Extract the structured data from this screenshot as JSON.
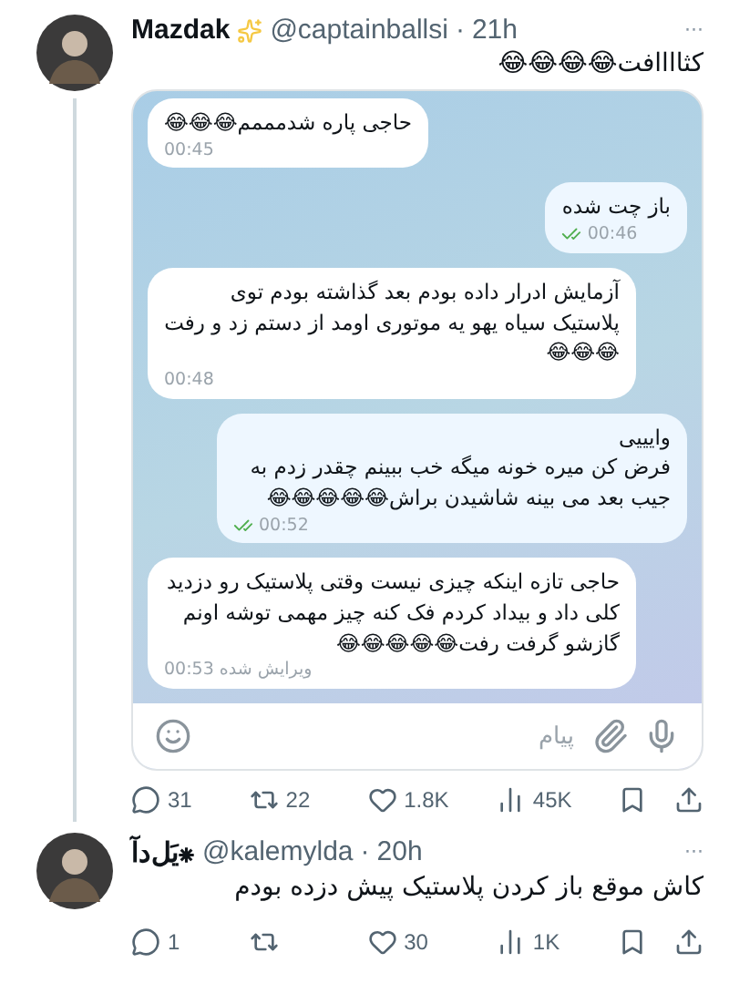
{
  "tweets": [
    {
      "author": "Mazdak",
      "verified_sparkle": true,
      "handle": "@captainballsi",
      "separator": "·",
      "time": "21h",
      "more": "···",
      "text": "کثاااافت😂😂😂😂",
      "chat": {
        "messages": [
          {
            "kind": "in",
            "text": "حاجی پاره شدمممم😂😂😂",
            "time": "00:45"
          },
          {
            "kind": "out",
            "text": "باز چت شده",
            "time": "00:46",
            "read": true
          },
          {
            "kind": "in",
            "text": "آزمایش ادرار داده بودم بعد گذاشته بودم توی پلاستیک سیاه یهو یه موتوری اومد از دستم زد و رفت😂😂😂",
            "time": "00:48"
          },
          {
            "kind": "out",
            "text": "وایییی\nفرض کن میره خونه میگه خب ببینم چقدر زدم به جیب بعد می بینه شاشیدن براش😂😂😂😂😂",
            "time": "00:52",
            "read": true
          },
          {
            "kind": "in",
            "text": "حاجی تازه اینکه چیزی نیست وقتی پلاستیک رو دزدید کلی داد و بیداد کردم فک کنه چیز مهمی توشه اونم گازشو گرفت رفت😂😂😂😂😂",
            "edited": "ویرایش شده",
            "time": "00:53"
          }
        ],
        "input": {
          "placeholder": "پیام"
        }
      },
      "action_counts": {
        "reply": "31",
        "repost": "22",
        "like": "1.8K",
        "views": "45K"
      }
    },
    {
      "author": "یَل‌دآ⁕",
      "verified_sparkle": false,
      "handle": "@kalemylda",
      "separator": "·",
      "time": "20h",
      "more": "···",
      "text": "کاش موقع باز کردن پلاستیک پیش دزده بودم",
      "action_counts": {
        "reply": "1",
        "like": "30",
        "views": "1K"
      }
    }
  ]
}
